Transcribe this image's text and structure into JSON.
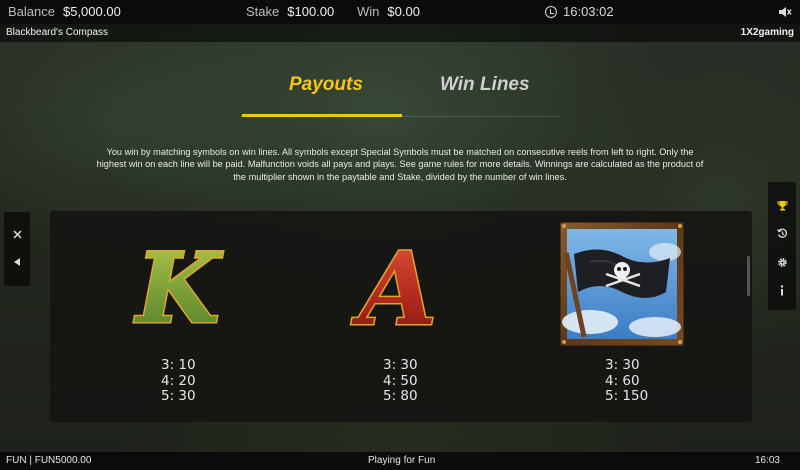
{
  "topbar": {
    "balance_label": "Balance",
    "balance_value": "$5,000.00",
    "stake_label": "Stake",
    "stake_value": "$100.00",
    "win_label": "Win",
    "win_value": "$0.00",
    "time": "16:03:02",
    "icons": [
      "clock-icon",
      "sound-icon"
    ]
  },
  "titlebar": {
    "game_title": "Blackbeard's Compass",
    "brand": "1X2gaming"
  },
  "tabs": [
    {
      "label": "Payouts",
      "active": true,
      "color": "#f5c518"
    },
    {
      "label": "Win Lines",
      "active": false,
      "color": "#cfcfcf"
    }
  ],
  "description": "You win by matching symbols on win lines. All symbols except Special Symbols must be matched on consecutive reels from left to right. Only the highest win on each line will be paid. Malfunction voids all pays and plays. See game rules for more details. Winnings are calculated as the product of the multiplier shown in the paytable and Stake, divided by the number of win lines.",
  "left_panel": {
    "icons": [
      "close-icon",
      "back-arrow-icon"
    ]
  },
  "right_panel": {
    "icons": [
      "trophy-icon",
      "history-icon",
      "settings-icon",
      "info-icon"
    ]
  },
  "symbols": [
    {
      "name": "K",
      "letter": "K",
      "pays": [
        "3: 10",
        "4: 20",
        "5: 30"
      ]
    },
    {
      "name": "A",
      "letter": "A",
      "pays": [
        "3: 30",
        "4: 50",
        "5: 80"
      ]
    },
    {
      "name": "pirate-flag",
      "pays": [
        "3: 30",
        "4: 60",
        "5: 150"
      ]
    }
  ],
  "bottombar": {
    "mode": "FUN | FUN5000.00",
    "status": "Playing for Fun",
    "time": "16:03"
  },
  "colors": {
    "accent": "#f5c518",
    "panel": "#141412",
    "bar": "#0b0b0b"
  }
}
